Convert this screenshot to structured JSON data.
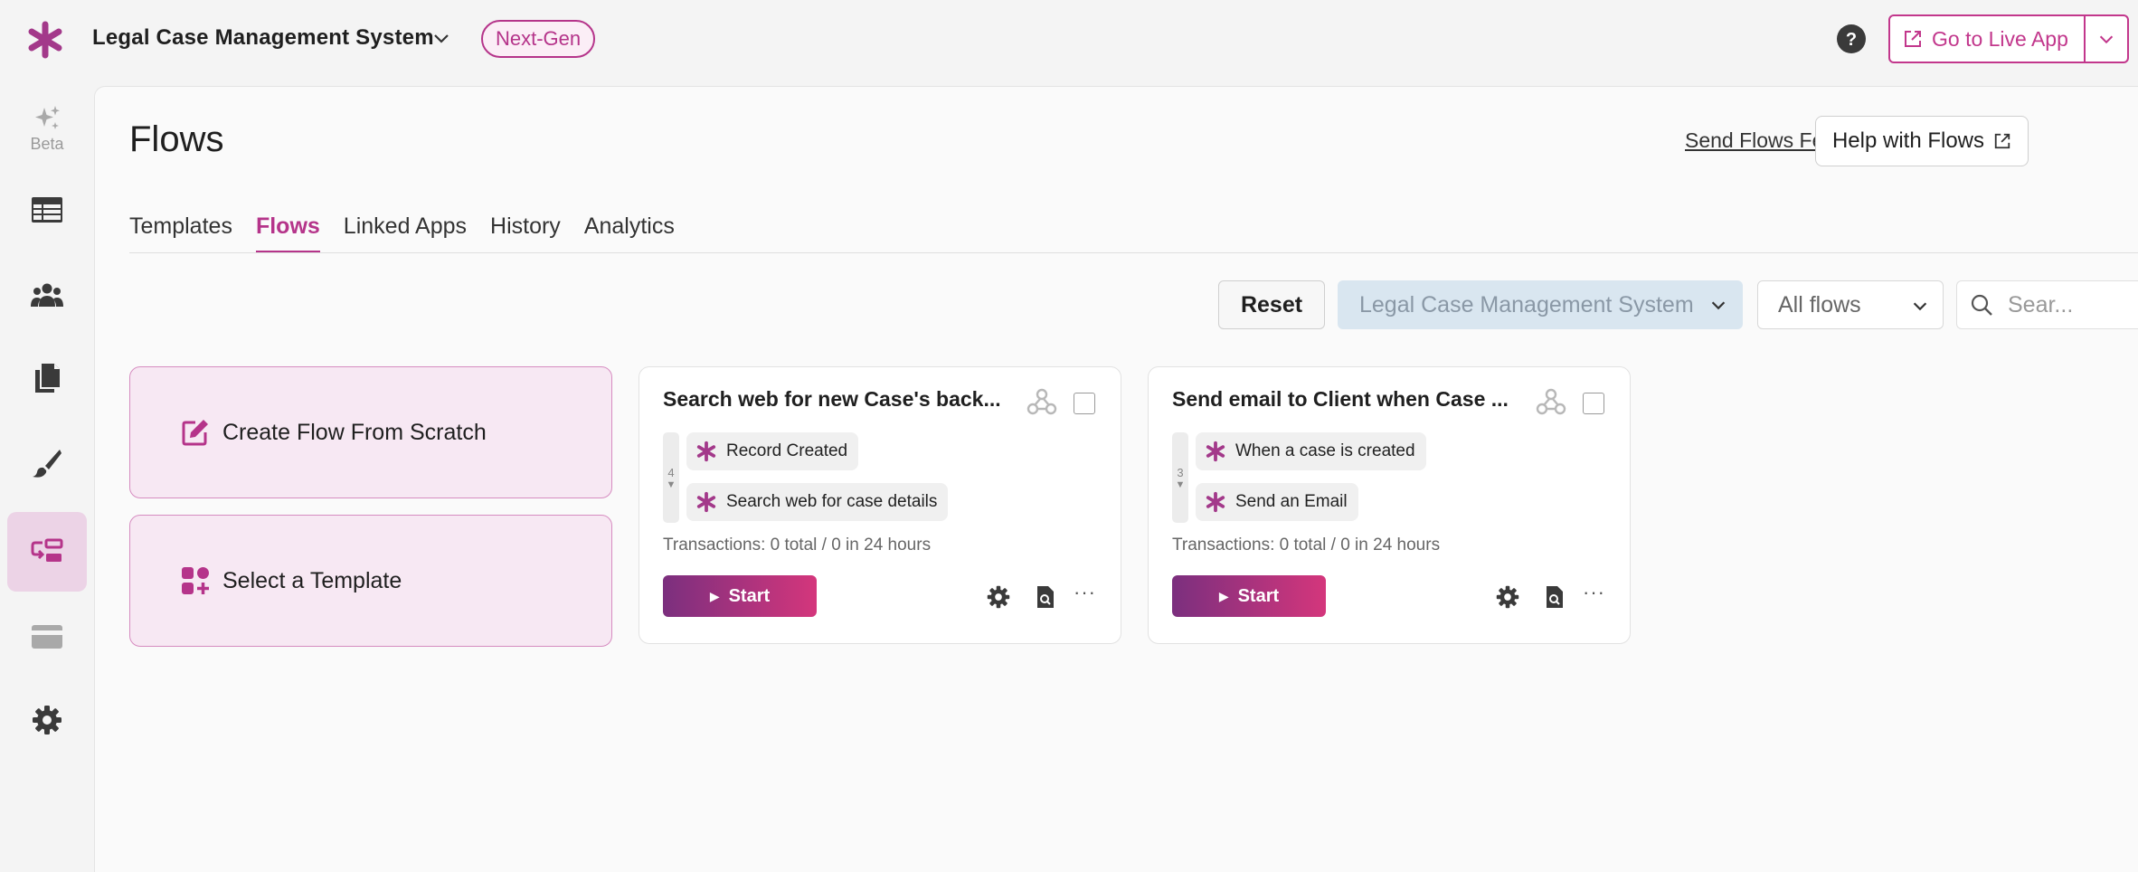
{
  "header": {
    "app_title": "Legal Case Management System",
    "badge": "Next-Gen",
    "live_button": "Go to Live App"
  },
  "sidebar": {
    "items": [
      {
        "icon": "sparkles-icon",
        "label": "Beta"
      },
      {
        "icon": "table-icon"
      },
      {
        "icon": "users-icon"
      },
      {
        "icon": "documents-icon"
      },
      {
        "icon": "paintbrush-icon"
      },
      {
        "icon": "flows-icon",
        "active": true
      },
      {
        "icon": "card-icon"
      },
      {
        "icon": "gear-icon"
      }
    ]
  },
  "page": {
    "title": "Flows",
    "feedback_link": "Send Flows Feedback",
    "help_button": "Help with Flows"
  },
  "tabs": [
    {
      "label": "Templates"
    },
    {
      "label": "Flows",
      "active": true
    },
    {
      "label": "Linked Apps"
    },
    {
      "label": "History"
    },
    {
      "label": "Analytics"
    }
  ],
  "filters": {
    "reset": "Reset",
    "app_select": "Legal Case Management System",
    "flows_select": "All flows",
    "search_placeholder": "Sear..."
  },
  "actions": {
    "create": "Create Flow From Scratch",
    "template": "Select a Template"
  },
  "flows": [
    {
      "title": "Search web for new Case's back...",
      "step_count": "4",
      "steps": [
        "Record Created",
        "Search web for case details"
      ],
      "transactions": "Transactions: 0 total / 0 in 24 hours",
      "start": "Start"
    },
    {
      "title": "Send email to Client when Case ...",
      "step_count": "3",
      "steps": [
        "When a case is created",
        "Send an Email"
      ],
      "transactions": "Transactions: 0 total / 0 in 24 hours",
      "start": "Start"
    }
  ],
  "colors": {
    "accent": "#b5348a",
    "active_bg": "#ecd3e6",
    "card_bg": "#f7e8f3",
    "select_bg": "#d9e6f0"
  }
}
